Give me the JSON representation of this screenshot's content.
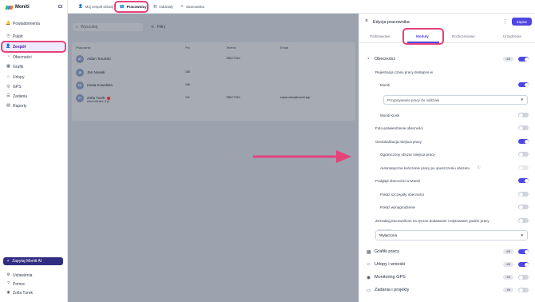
{
  "app": {
    "name": "Moniti"
  },
  "sidebar": {
    "items": [
      {
        "label": "Powiadomienia",
        "icon": "bell-icon",
        "glyph": "🔔"
      },
      {
        "label": "Pulpit",
        "icon": "dashboard-icon",
        "glyph": "◷"
      },
      {
        "label": "Zespół",
        "icon": "person-icon",
        "glyph": "👤",
        "active": true
      },
      {
        "label": "Obecności",
        "icon": "clock-icon",
        "glyph": "◔"
      },
      {
        "label": "Grafik",
        "icon": "calendar-icon",
        "glyph": "▦"
      },
      {
        "label": "Urlopy",
        "icon": "sun-icon",
        "glyph": "☼"
      },
      {
        "label": "GPS",
        "icon": "location-icon",
        "glyph": "◎"
      },
      {
        "label": "Zadania",
        "icon": "checklist-icon",
        "glyph": "☰"
      },
      {
        "label": "Raporty",
        "icon": "report-icon",
        "glyph": "▤"
      }
    ],
    "ai_button": "Zapytaj Moniti AI",
    "bottom": [
      {
        "label": "Ustawienia",
        "icon": "gear-icon",
        "glyph": "⚙"
      },
      {
        "label": "Pomoc",
        "icon": "help-icon",
        "glyph": "?"
      },
      {
        "label": "Zofia Turek",
        "icon": "user-icon",
        "glyph": "◉"
      }
    ]
  },
  "topnav": {
    "tabs": [
      {
        "label": "Mój zespół dzisiaj"
      },
      {
        "label": "Pracownicy",
        "active": true
      },
      {
        "label": "Oddziały"
      },
      {
        "label": "Stanowiska"
      }
    ]
  },
  "main": {
    "search_placeholder": "Wyszukaj",
    "filters_label": "Filtry",
    "columns": [
      "Pracownik",
      "Pin",
      "Telefon",
      "Email"
    ],
    "rows": [
      {
        "initials": "AT",
        "name": "Adam Toruński",
        "sub": "",
        "pin": "",
        "phone": "785177040",
        "email": ""
      },
      {
        "initials": "JN",
        "name": "Jan Nowak",
        "sub": "",
        "pin": "158",
        "phone": "",
        "email": ""
      },
      {
        "initials": "KK",
        "name": "Kasia Kowalska",
        "sub": "",
        "pin": "156",
        "phone": "",
        "email": ""
      },
      {
        "initials": "ZT",
        "name": "Zofia Turek",
        "sub": "Administrator (Ty)",
        "pin": "121",
        "phone": "785177040",
        "email": "edyta.osika@moniti.app"
      }
    ]
  },
  "panel": {
    "title": "Edycja pracownika",
    "save": "Zapisz",
    "tabs": [
      "Podstawowe",
      "Moduły",
      "Rozliczeniowe",
      "Urządzenia"
    ],
    "active_tab": "Moduły",
    "attendance": {
      "label": "Obecności",
      "count": "4/5",
      "registration_label": "Rejestracja czasu pracy dostępna w",
      "moniti_label": "Moniti",
      "assign_placeholder": "Przypisywanie pracy do oddziału",
      "kiosk_label": "Moniti Kiosk",
      "photo_label": "Foto-potwierdzenie obecności",
      "geo_label": "Geolokalizacja miejsca pracy",
      "limited_label": "Ograniczony obszar miejsca pracy",
      "auto_end_label": "Automatyczne kończenie pracy po opuszczeniu obszaru",
      "preview_label": "Podgląd obecności w Moniti",
      "details_label": "Pokaż szczegóły obecności",
      "salary_label": "Pokaż wynagrodzenie",
      "manual_label": "Zezwalaj pracownikom na ręczne dodawanie i edytowanie godzin pracy",
      "overtime_field_label": "Praca zdalna",
      "overtime_value": "Wyłączona"
    },
    "modules": [
      {
        "label": "Grafiki pracy",
        "icon": "calendar-icon",
        "glyph": "▦",
        "count": "4/5",
        "on": true
      },
      {
        "label": "Urlopy i wnioski",
        "icon": "sun-icon",
        "glyph": "☼",
        "count": "4/5",
        "on": true
      },
      {
        "label": "Monitoring GPS",
        "icon": "location-icon",
        "glyph": "◉",
        "count": "1/5",
        "on": false
      },
      {
        "label": "Zadania i projekty",
        "icon": "folder-icon",
        "glyph": "▭",
        "count": "1/5",
        "on": false
      }
    ]
  },
  "colors": {
    "accent": "#4f46e5",
    "highlight": "#e6427c",
    "overlay": "#9ca3af"
  }
}
